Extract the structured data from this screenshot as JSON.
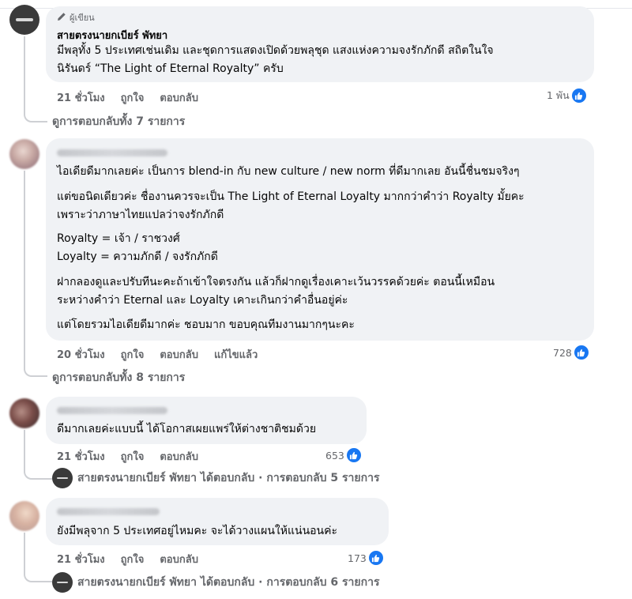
{
  "colors": {
    "bubble": "#f0f2f5",
    "like": "#1877f2",
    "muted": "#65676b"
  },
  "comments": [
    {
      "author_tag": "ผู้เขียน",
      "name": "สายตรงนายกเบียร์ พัทยา",
      "lines": [
        "มีพลุทั้ง 5 ประเทศเช่นเดิม และชุดการแสดงเปิดด้วยพลุชุด แสงแห่งความจงรักภักดี สถิตในใจ",
        "นิรันดร์ “The Light of Eternal Royalty” ครับ"
      ],
      "time": "21 ชั่วโมง",
      "like": "ถูกใจ",
      "reply": "ตอบกลับ",
      "reactions": "1 พัน",
      "view_replies": "ดูการตอบกลับทั้ง 7 รายการ"
    },
    {
      "lines": [
        "ไอเดียดีมากเลยค่ะ เป็นการ blend-in กับ new culture / new norm ที่ดีมากเลย อันนี้ชื่นชมจริงๆ",
        "แต่ขอนิดเดียวค่ะ ชื่องานควรจะเป็น The Light of Eternal Loyalty มากกว่าคำว่า Royalty มั้ยคะ",
        "เพราะว่าภาษาไทยแปลว่าจงรักภักดี",
        "Royalty = เจ้า / ราชวงศ์",
        "Loyalty = ความภักดี / จงรักภักดี",
        "ฝากลองดูและปรับทีนะคะถ้าเข้าใจตรงกัน แล้วก็ฝากดูเรื่องเคาะเว้นวรรคด้วยค่ะ ตอนนี้เหมือน",
        "ระหว่างคำว่า Eternal และ Loyalty เคาะเกินกว่าคำอื่นอยู่ค่ะ",
        "แต่โดยรวมไอเดียดีมากค่ะ ชอบมาก ขอบคุณทีมงานมากๆนะคะ"
      ],
      "time": "20 ชั่วโมง",
      "like": "ถูกใจ",
      "reply": "ตอบกลับ",
      "edited": "แก้ไขแล้ว",
      "reactions": "728",
      "view_replies": "ดูการตอบกลับทั้ง 8 รายการ"
    },
    {
      "lines": [
        "ดีมากเลยค่ะแบบนี้ ได้โอกาสเผยแพร่ให้ต่างชาติชมด้วย"
      ],
      "time": "21 ชั่วโมง",
      "like": "ถูกใจ",
      "reply": "ตอบกลับ",
      "reactions": "653",
      "reply_summary": "สายตรงนายกเบียร์ พัทยา ได้ตอบกลับ · การตอบกลับ 5 รายการ"
    },
    {
      "lines": [
        "ยังมีพลุจาก 5 ประเทศอยู่ไหมคะ จะได้วางแผนให้แน่นอนค่ะ"
      ],
      "time": "21 ชั่วโมง",
      "like": "ถูกใจ",
      "reply": "ตอบกลับ",
      "reactions": "173",
      "reply_summary": "สายตรงนายกเบียร์ พัทยา ได้ตอบกลับ · การตอบกลับ 6 รายการ"
    }
  ]
}
